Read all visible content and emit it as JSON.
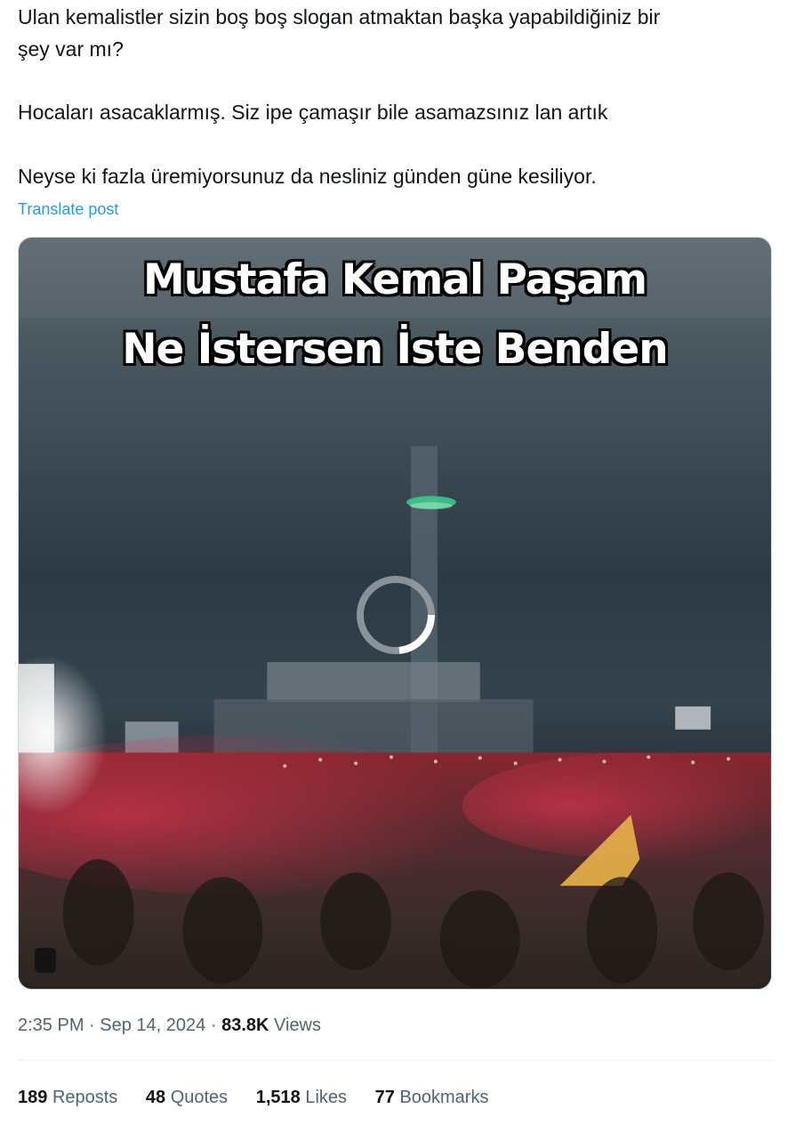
{
  "tweet": {
    "lines": [
      "Ulan kemalistler sizin boş boş slogan atmaktan başka yapabildiğiniz bir",
      "şey var mı?",
      "Hocaları asacaklarmış. Siz ipe çamaşır bile asamazsınız lan artık",
      "Neyse ki fazla üremiyorsunuz da nesliniz günden güne kesiliyor."
    ],
    "translate_label": "Translate post"
  },
  "media": {
    "caption_line1": "Mustafa Kemal Paşam",
    "caption_line2": "Ne İstersen İste Benden",
    "state": "loading"
  },
  "meta": {
    "time": "2:35 PM",
    "separator": "·",
    "date": "Sep 14, 2024",
    "views_count": "83.8K",
    "views_label": "Views"
  },
  "stats": [
    {
      "count": "189",
      "label": "Reposts"
    },
    {
      "count": "48",
      "label": "Quotes"
    },
    {
      "count": "1,518",
      "label": "Likes"
    },
    {
      "count": "77",
      "label": "Bookmarks"
    }
  ],
  "colors": {
    "link": "#1d9bf0",
    "text": "#0f1419",
    "muted": "#536471"
  }
}
